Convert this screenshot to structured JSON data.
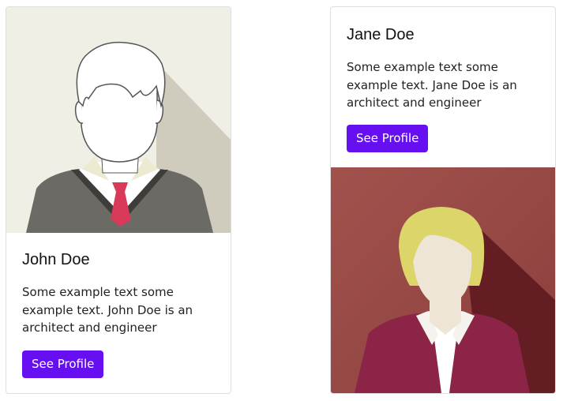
{
  "cards": [
    {
      "name": "John Doe",
      "text": "Some example text some example text. John Doe is an architect and engineer",
      "button_label": "See Profile",
      "avatar_icon": "male-avatar-icon"
    },
    {
      "name": "Jane Doe",
      "text": "Some example text some example text. Jane Doe is an architect and engineer",
      "button_label": "See Profile",
      "avatar_icon": "female-avatar-icon"
    }
  ],
  "colors": {
    "button": "#6610f2",
    "male_avatar_bg": "#f0efe5",
    "female_avatar_bg": "#9b4f4b",
    "female_jacket": "#8b2447"
  }
}
